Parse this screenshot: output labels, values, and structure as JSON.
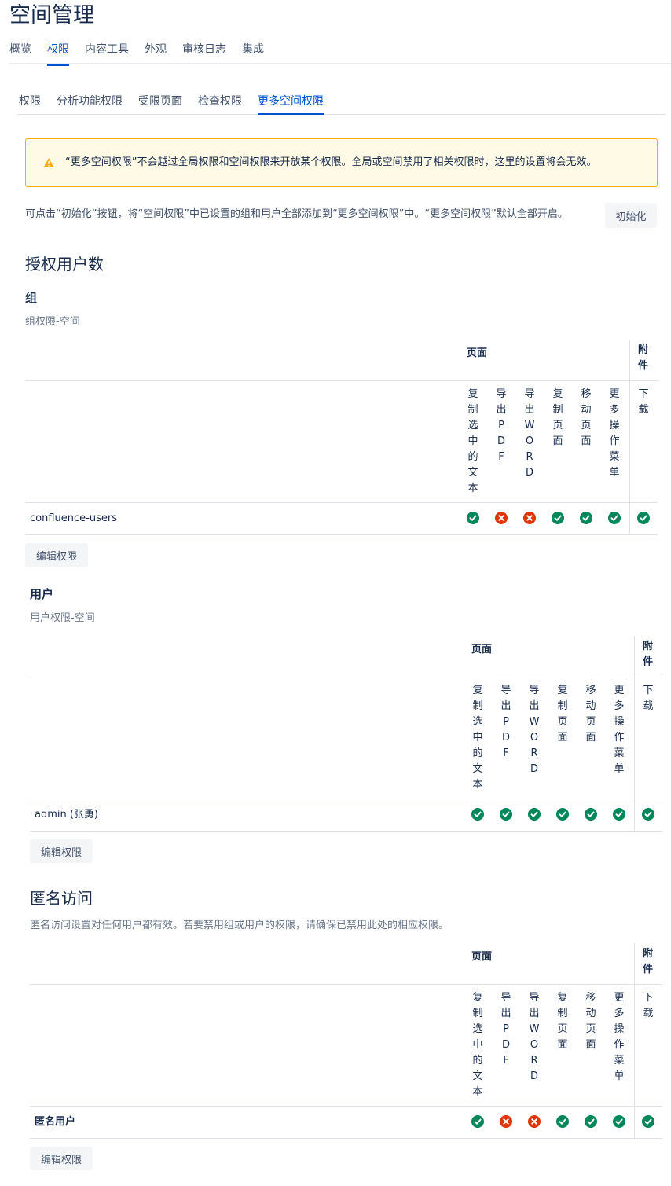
{
  "title": "空间管理",
  "tabs": [
    "概览",
    "权限",
    "内容工具",
    "外观",
    "审核日志",
    "集成"
  ],
  "subtabs": [
    "权限",
    "分析功能权限",
    "受限页面",
    "检查权限",
    "更多空间权限"
  ],
  "warning": "“更多空间权限”不会越过全局权限和空间权限来开放某个权限。全局或空间禁用了相关权限时，这里的设置将会无效。",
  "info": "可点击“初始化”按钮，将“空间权限”中已设置的组和用户全部添加到“更多空间权限”中。“更多空间权限”默认全部开启。",
  "init_button": "初始化",
  "licensed_heading": "授权用户数",
  "columns_page_group": "页面",
  "columns_attach_group": "附件",
  "columns": [
    "复制选中的文本",
    "导出PDF",
    "导出WORD",
    "复制页面",
    "移动页面",
    "更多操作菜单",
    "下载"
  ],
  "edit_button": "编辑权限",
  "sections": [
    {
      "heading": "组",
      "description": "组权限-空间",
      "rows": [
        {
          "name": "confluence-users",
          "perms": [
            true,
            false,
            false,
            true,
            true,
            true,
            true
          ]
        }
      ]
    },
    {
      "heading": "用户",
      "description": "用户权限-空间",
      "rows": [
        {
          "name": "admin (张勇)",
          "perms": [
            true,
            true,
            true,
            true,
            true,
            true,
            true
          ]
        }
      ]
    },
    {
      "heading": "匿名访问",
      "description": "匿名访问设置对任何用户都有效。若要禁用组或用户的权限，请确保已禁用此处的相应权限。",
      "rows": [
        {
          "name": "匿名用户",
          "perms": [
            true,
            false,
            false,
            true,
            true,
            true,
            true
          ]
        }
      ]
    }
  ],
  "colors": {
    "accent": "#0052cc",
    "yes": "#00875a",
    "no": "#de350b",
    "warning": "#ffab00"
  },
  "icons": {
    "warning": "warning-icon",
    "yes": "check-circle-icon",
    "no": "cross-circle-icon"
  }
}
